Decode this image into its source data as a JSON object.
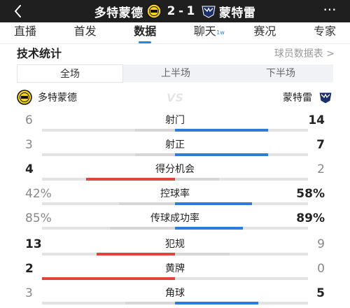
{
  "header": {
    "home_team": "多特蒙德",
    "home_score": "2",
    "separator": "-",
    "away_score": "1",
    "away_team": "蒙特雷",
    "more_label": "···"
  },
  "tabs": [
    {
      "label": "直播"
    },
    {
      "label": "首发"
    },
    {
      "label": "数据"
    },
    {
      "label": "聊天",
      "badge": "1w"
    },
    {
      "label": "赛况"
    },
    {
      "label": "专家"
    }
  ],
  "section": {
    "title": "技术统计",
    "player_link": "球员数据表 >"
  },
  "segments": [
    "全场",
    "上半场",
    "下半场"
  ],
  "teams": {
    "home": "多特蒙德",
    "vs": "VS",
    "away": "蒙特雷"
  },
  "colors": {
    "home_accent": "#e0463c",
    "away_accent": "#2f7bd9",
    "track": "#e3e3e3"
  },
  "stats": [
    {
      "label": "射门",
      "home": "6",
      "away": "14",
      "home_value": 6,
      "away_value": 14,
      "leader": "away"
    },
    {
      "label": "射正",
      "home": "3",
      "away": "7",
      "home_value": 3,
      "away_value": 7,
      "leader": "away"
    },
    {
      "label": "得分机会",
      "home": "4",
      "away": "2",
      "home_value": 4,
      "away_value": 2,
      "leader": "home"
    },
    {
      "label": "控球率",
      "home": "42%",
      "away": "58%",
      "home_value": 42,
      "away_value": 58,
      "leader": "away"
    },
    {
      "label": "传球成功率",
      "home": "85%",
      "away": "89%",
      "home_value": 85,
      "away_value": 89,
      "leader": "away"
    },
    {
      "label": "犯规",
      "home": "13",
      "away": "9",
      "home_value": 13,
      "away_value": 9,
      "leader": "home"
    },
    {
      "label": "黄牌",
      "home": "2",
      "away": "0",
      "home_value": 2,
      "away_value": 0,
      "leader": "home"
    },
    {
      "label": "角球",
      "home": "3",
      "away": "5",
      "home_value": 3,
      "away_value": 5,
      "leader": "away"
    }
  ]
}
